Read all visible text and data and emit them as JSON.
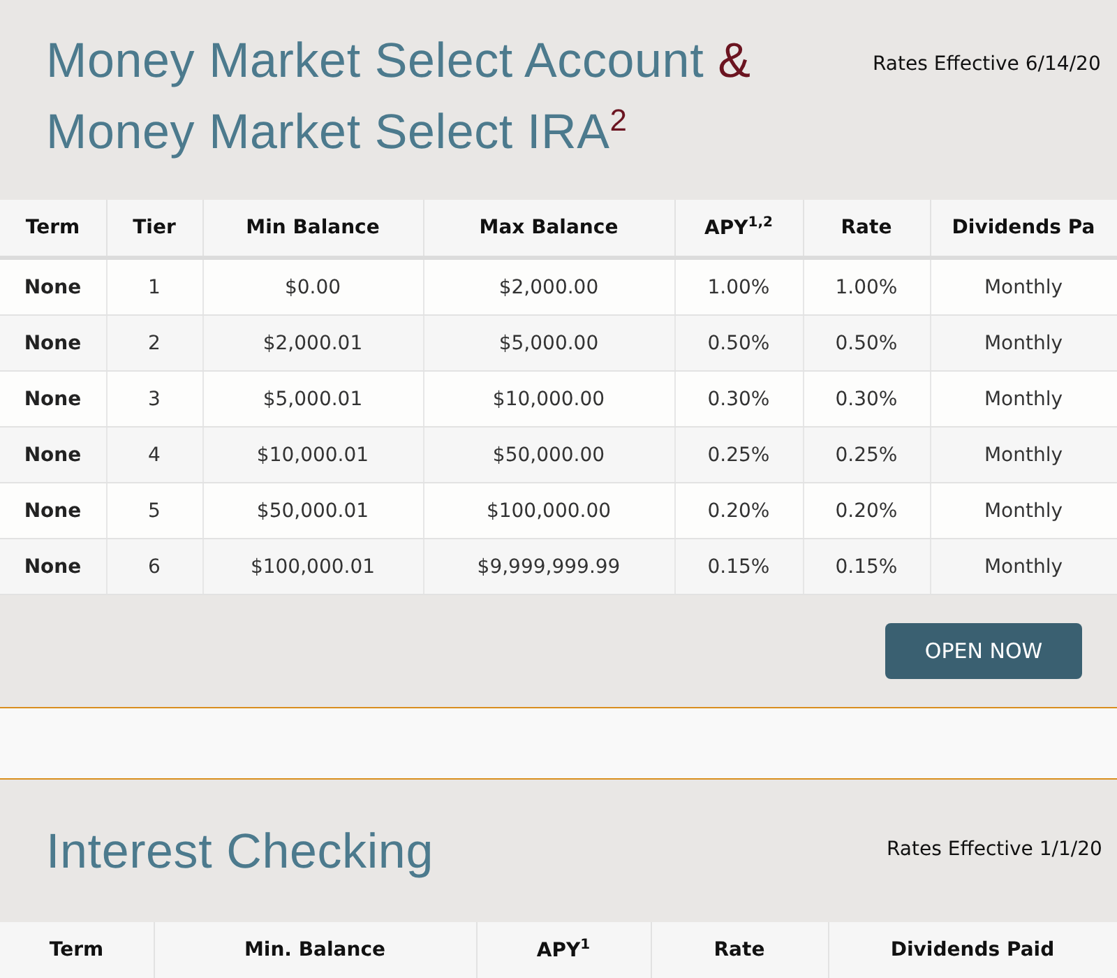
{
  "sections": [
    {
      "title": {
        "line_1": "Money Market Select Account",
        "ampersand": "&",
        "line_2": "Money Market Select IRA",
        "footnote": "2"
      },
      "rates_effective": "Rates Effective 6/14/20",
      "table": {
        "columns": [
          "Term",
          "Tier",
          "Min Balance",
          "Max Balance",
          "APY$^{1,2}$",
          "Rate",
          "Dividends Pa"
        ],
        "rows": [
          [
            "None",
            "1",
            "$0.00",
            "$2,000.00",
            "1.00%",
            "1.00%",
            "Monthly"
          ],
          [
            "None",
            "2",
            "$2,000.01",
            "$5,000.00",
            "0.50%",
            "0.50%",
            "Monthly"
          ],
          [
            "None",
            "3",
            "$5,000.01",
            "$10,000.00",
            "0.30%",
            "0.30%",
            "Monthly"
          ],
          [
            "None",
            "4",
            "$10,000.01",
            "$50,000.00",
            "0.25%",
            "0.25%",
            "Monthly"
          ],
          [
            "None",
            "5",
            "$50,000.01",
            "$100,000.00",
            "0.20%",
            "0.20%",
            "Monthly"
          ],
          [
            "None",
            "6",
            "$100,000.01",
            "$9,999,999.99",
            "0.15%",
            "0.15%",
            "Monthly"
          ]
        ]
      },
      "button": "OPEN NOW"
    },
    {
      "title": {
        "line_1": "Interest Checking"
      },
      "rates_effective": "Rates Effective 1/1/20",
      "table": {
        "columns": [
          "Term",
          "Min. Balance",
          "APY$^{1}$",
          "Rate",
          "Dividends Paid"
        ]
      }
    }
  ]
}
